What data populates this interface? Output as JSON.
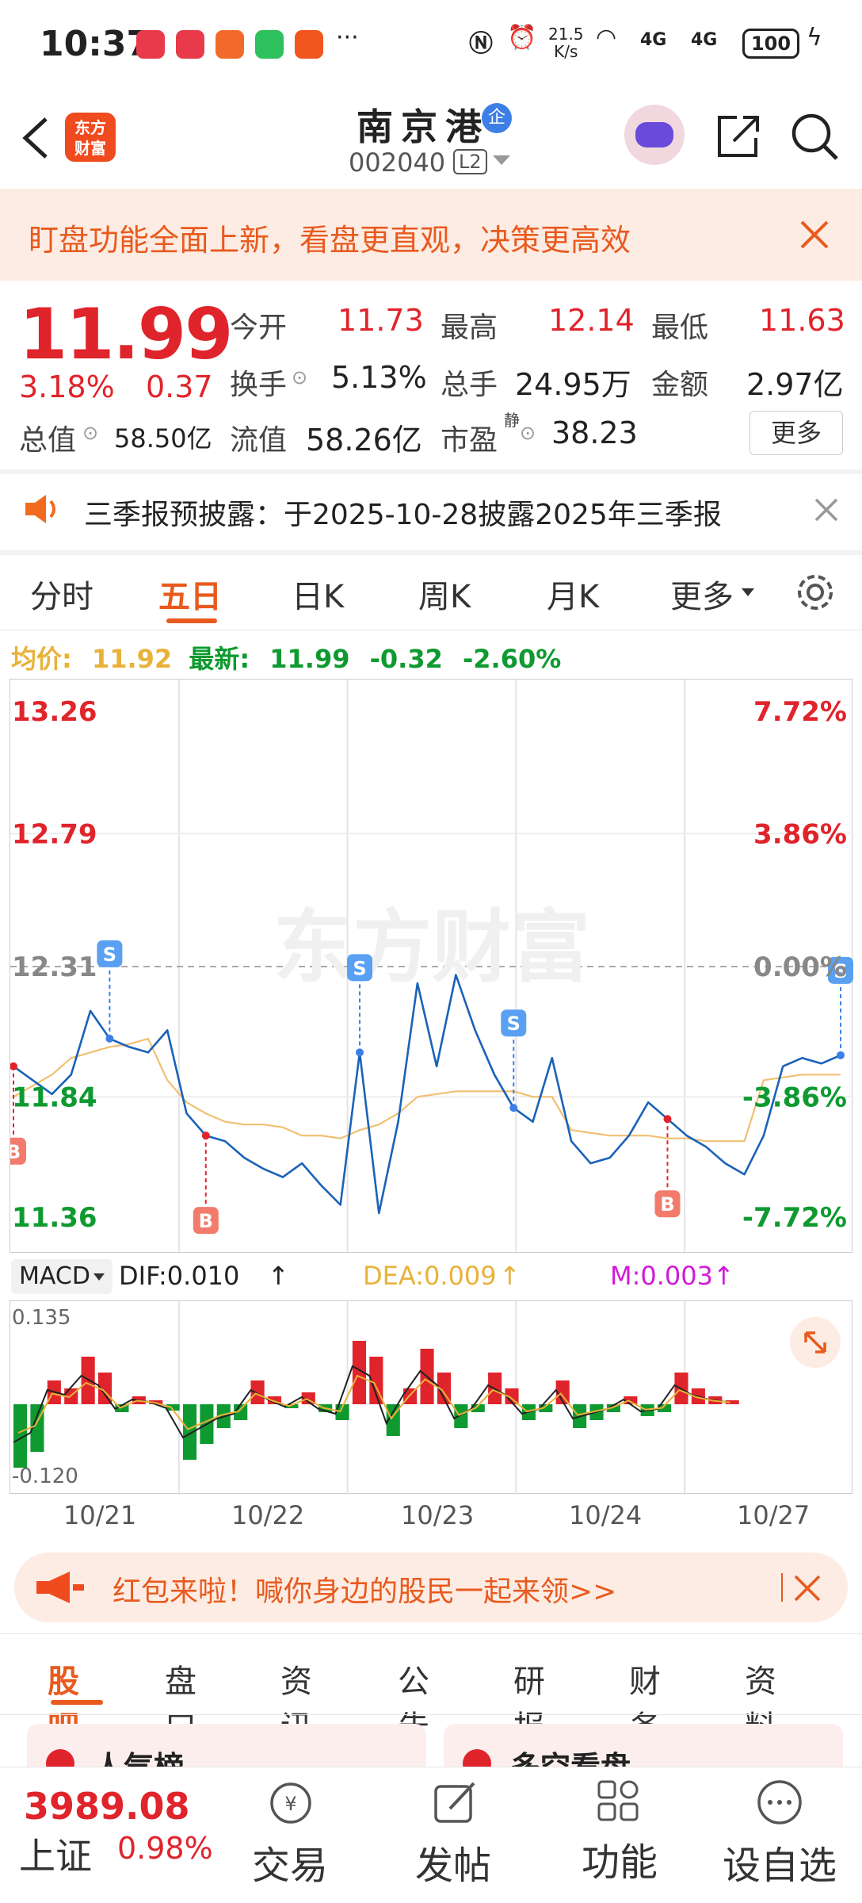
{
  "status_bar": {
    "time": "10:37",
    "net_speed_top": "21.5",
    "net_speed_bottom": "K/s",
    "signal1": "4G",
    "signal2": "4G",
    "battery": "100",
    "more": "···"
  },
  "header": {
    "title": "南京港",
    "badge": "企",
    "code": "002040",
    "level": "L2",
    "logo_text_line1": "东方",
    "logo_text_line2": "财富"
  },
  "notice_banner": {
    "text": "盯盘功能全面上新，看盘更直观，决策更高效"
  },
  "quote": {
    "price": "11.99",
    "change_pct": "3.18%",
    "change_amt": "0.37",
    "open_label": "今开",
    "open": "11.73",
    "high_label": "最高",
    "high": "12.14",
    "low_label": "最低",
    "low": "11.63",
    "turnover_label": "换手",
    "turnover": "5.13%",
    "volume_label": "总手",
    "volume": "24.95万",
    "amount_label": "金额",
    "amount": "2.97亿",
    "mktcap_label": "总值",
    "mktcap": "58.50亿",
    "float_label": "流值",
    "float_cap": "58.26亿",
    "pe_label": "市盈",
    "pe_sup": "静",
    "pe": "38.23",
    "more_button": "更多"
  },
  "announcement": {
    "text": "三季报预披露：于2025-10-28披露2025年三季报"
  },
  "chart_tabs": [
    "分时",
    "五日",
    "日K",
    "周K",
    "月K",
    "更多"
  ],
  "chart_tab_selected": "五日",
  "legend": {
    "avg_label": "均价:",
    "avg": "11.92",
    "latest_label": "最新:",
    "latest": "11.99",
    "chg": "-0.32",
    "chg_pct": "-2.60%"
  },
  "watermark": "东方财富",
  "macd": {
    "selector": "MACD",
    "dif": "DIF:0.010",
    "dea": "DEA:0.009",
    "m": "M:0.003",
    "ymax_label": "0.135",
    "ymin_label": "-0.120"
  },
  "date_labels": [
    "10/21",
    "10/22",
    "10/23",
    "10/24",
    "10/27"
  ],
  "chart_data": {
    "type": "line",
    "title": "",
    "y_tick_labels": [
      "13.26",
      "12.79",
      "12.31",
      "11.84",
      "11.36"
    ],
    "y_right_tick_labels": [
      "7.72%",
      "3.86%",
      "0.00%",
      "-3.86%",
      "-7.72%"
    ],
    "ylim": [
      11.36,
      13.26
    ],
    "reference": 12.31,
    "x_categories": [
      "10/21",
      "10/22",
      "10/23",
      "10/24",
      "10/27"
    ],
    "series": [
      {
        "values": [
          11.95,
          11.9,
          11.85,
          11.92,
          12.15,
          12.05,
          12.02,
          12.0,
          12.08,
          11.78,
          11.7,
          11.68,
          11.62,
          11.58,
          11.55,
          11.6,
          11.52,
          11.45,
          12.0,
          11.42,
          11.75,
          12.25,
          11.95,
          12.28,
          12.08,
          11.92,
          11.8,
          11.75,
          11.98,
          11.68,
          11.6,
          11.62,
          11.7,
          11.82,
          11.76,
          11.7,
          11.66,
          11.6,
          11.56,
          11.7,
          11.95,
          11.98,
          11.96,
          11.99
        ]
      },
      {
        "values": [
          11.84,
          11.88,
          11.92,
          11.98,
          12.0,
          12.02,
          12.03,
          12.05,
          11.9,
          11.82,
          11.78,
          11.75,
          11.74,
          11.74,
          11.73,
          11.7,
          11.7,
          11.69,
          11.72,
          11.74,
          11.78,
          11.84,
          11.85,
          11.86,
          11.86,
          11.86,
          11.86,
          11.84,
          11.84,
          11.72,
          11.71,
          11.7,
          11.7,
          11.7,
          11.69,
          11.69,
          11.68,
          11.68,
          11.68,
          11.9,
          11.91,
          11.92,
          11.92,
          11.92
        ]
      }
    ],
    "trade_marks": [
      "B",
      "S",
      "B",
      "S",
      "S",
      "B",
      "S"
    ]
  },
  "red_packet_banner": {
    "text": "红包来啦！喊你身边的股民一起来领>>"
  },
  "bottom_tabs": [
    "股吧",
    "盘口",
    "资讯",
    "公告",
    "研报",
    "财务",
    "资料"
  ],
  "bottom_tab_selected": "股吧",
  "peek_cards": [
    "人气榜",
    "多空看盘"
  ],
  "bottom_nav": {
    "index_value": "3989.08",
    "index_name": "上证",
    "index_pct": "0.98%",
    "trade": "交易",
    "post": "发帖",
    "features": "功能",
    "watchlist": "设自选"
  }
}
